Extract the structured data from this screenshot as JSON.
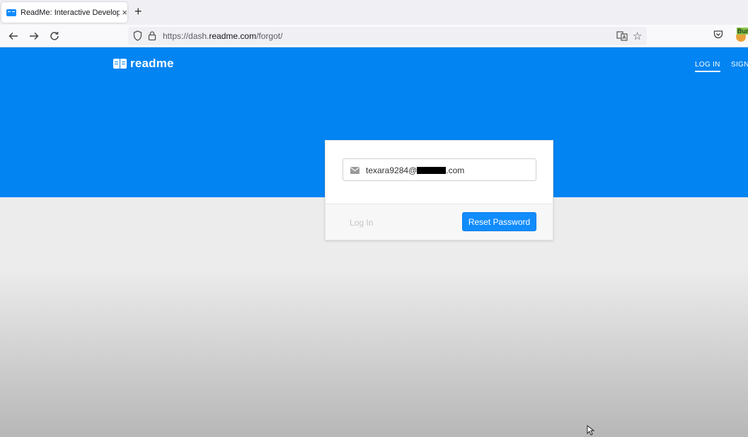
{
  "browser": {
    "tab_title": "ReadMe: Interactive Developer",
    "tab_close": "×",
    "new_tab": "+",
    "url_prefix": "https://dash.",
    "url_domain": "readme.com",
    "url_path": "/forgot/",
    "extension_label": "Bur"
  },
  "page": {
    "logo_text": "readme",
    "nav": {
      "login": "LOG IN",
      "signup": "SIGN"
    },
    "form": {
      "email_prefix": "texara9284@",
      "email_suffix": ".com",
      "login_link": "Log In",
      "reset_button": "Reset Password"
    }
  },
  "colors": {
    "brand_blue": "#0284f2",
    "button_blue": "#118cfd"
  }
}
